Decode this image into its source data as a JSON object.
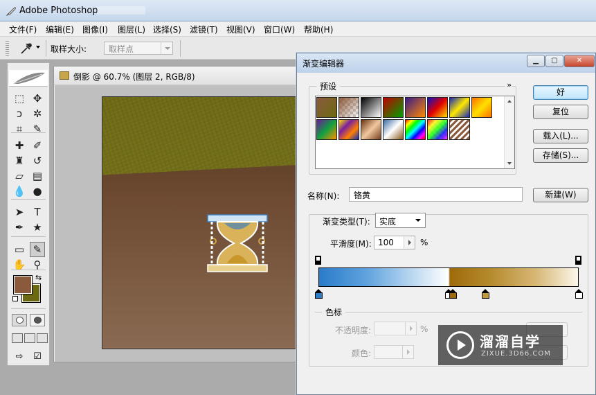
{
  "app": {
    "title": "Adobe Photoshop"
  },
  "menu": [
    {
      "label": "文件(F)"
    },
    {
      "label": "编辑(E)"
    },
    {
      "label": "图像(I)"
    },
    {
      "label": "图层(L)"
    },
    {
      "label": "选择(S)"
    },
    {
      "label": "滤镜(T)"
    },
    {
      "label": "视图(V)"
    },
    {
      "label": "窗口(W)"
    },
    {
      "label": "帮助(H)"
    }
  ],
  "options_bar": {
    "tool_icon": "eyedropper-icon",
    "sample_size_label": "取样大小:",
    "sample_size_value": "取样点"
  },
  "toolbox": {
    "tools": [
      {
        "name": "marquee-icon",
        "glyph": "⬚"
      },
      {
        "name": "move-icon",
        "glyph": "✥"
      },
      {
        "name": "lasso-icon",
        "glyph": "ↄ"
      },
      {
        "name": "magic-wand-icon",
        "glyph": "✲"
      },
      {
        "name": "crop-icon",
        "glyph": "⌗"
      },
      {
        "name": "slice-icon",
        "glyph": "✎"
      },
      {
        "name": "healing-brush-icon",
        "glyph": "✚"
      },
      {
        "name": "brush-icon",
        "glyph": "✐"
      },
      {
        "name": "clone-stamp-icon",
        "glyph": "♜"
      },
      {
        "name": "history-brush-icon",
        "glyph": "↺"
      },
      {
        "name": "eraser-icon",
        "glyph": "▱"
      },
      {
        "name": "gradient-icon",
        "glyph": "▤"
      },
      {
        "name": "blur-icon",
        "glyph": "💧"
      },
      {
        "name": "dodge-icon",
        "glyph": "●"
      },
      {
        "name": "path-selection-icon",
        "glyph": "➤"
      },
      {
        "name": "type-icon",
        "glyph": "T"
      },
      {
        "name": "pen-icon",
        "glyph": "✒"
      },
      {
        "name": "custom-shape-icon",
        "glyph": "★"
      },
      {
        "name": "notes-icon",
        "glyph": "▭"
      },
      {
        "name": "eyedropper-icon",
        "glyph": "✎"
      },
      {
        "name": "hand-icon",
        "glyph": "✋"
      },
      {
        "name": "zoom-icon",
        "glyph": "⚲"
      }
    ],
    "foreground_color": "#8b5a3c",
    "background_color": "#6b6a12"
  },
  "document": {
    "title": "倒影 @ 60.7% (图层 2, RGB/8)"
  },
  "gradient_editor": {
    "title": "渐变编辑器",
    "presets_label": "预设",
    "more_icon": "double-chevron-right-icon",
    "buttons": {
      "ok": "好",
      "reset": "复位",
      "load": "载入(L)...",
      "save": "存储(S)...",
      "new": "新建(W)"
    },
    "presets": [
      {
        "name": "foreground-to-background",
        "css": "linear-gradient(135deg,#8b5a3c,#6b6a12)"
      },
      {
        "name": "foreground-to-transparent",
        "css": "linear-gradient(135deg,#8b5a3c,rgba(139,90,60,0)),repeating-conic-gradient(#ccc 0 25%,#fff 0 50%) 0 0/8px 8px"
      },
      {
        "name": "black-white",
        "css": "linear-gradient(135deg,#000,#fff)"
      },
      {
        "name": "red-green",
        "css": "linear-gradient(135deg,#c00000,#00a000)"
      },
      {
        "name": "violet-orange",
        "css": "linear-gradient(135deg,#3a1a8a,#ff8a00)"
      },
      {
        "name": "blue-red-yellow",
        "css": "linear-gradient(135deg,#1010c0,#e00000,#ffe000)"
      },
      {
        "name": "blue-yellow-blue",
        "css": "linear-gradient(135deg,#1428b8,#ffe800,#1428b8)"
      },
      {
        "name": "orange-yellow-orange",
        "css": "linear-gradient(135deg,#ff7000,#ffe000,#ff7000)"
      },
      {
        "name": "violet-green-orange",
        "css": "linear-gradient(135deg,#6a1a9a,#10a040,#ff9000)"
      },
      {
        "name": "yellow-violet-orange-blue",
        "css": "linear-gradient(135deg,#ffe000,#7a20a0,#ff8000,#1030c0)"
      },
      {
        "name": "copper",
        "css": "linear-gradient(135deg,#6a3210,#f0c8a0,#7a4020)"
      },
      {
        "name": "chrome",
        "css": "linear-gradient(135deg,#3a6aa0,#fff 50%,#8a5a20)"
      },
      {
        "name": "spectrum",
        "css": "linear-gradient(135deg,#ff0000,#ffff00,#00ff00,#00ffff,#0000ff,#ff00ff,#ff0000)"
      },
      {
        "name": "transparent-rainbow",
        "css": "linear-gradient(135deg,rgba(255,0,0,.8),rgba(255,255,0,.8),rgba(0,255,0,.8),rgba(0,0,255,.8),rgba(255,0,255,.8)),repeating-conic-gradient(#ccc 0 25%,#fff 0 50%) 0 0/8px 8px"
      },
      {
        "name": "transparent-stripes",
        "css": "repeating-linear-gradient(135deg,#8b5a3c 0 3px,#fff 3px 6px)"
      }
    ],
    "name_label": "名称(N):",
    "name_value": "铬黄",
    "type_label": "渐变类型(T):",
    "type_value": "实底",
    "smoothness_label": "平滑度(M):",
    "smoothness_value": "100",
    "percent": "%",
    "stops": {
      "label": "色标",
      "opacity_label": "不透明度:",
      "opacity_percent": "%",
      "color_label": "颜色:"
    },
    "color_stops": [
      {
        "position": 0.0,
        "color": "#2a7bc8"
      },
      {
        "position": 0.5,
        "color": "#ffffff"
      },
      {
        "position": 0.516,
        "color": "#9e6a0a"
      },
      {
        "position": 0.64,
        "color": "#c39a3a"
      },
      {
        "position": 1.0,
        "color": "#ffffff"
      }
    ],
    "opacity_stops": [
      {
        "position": 0.0,
        "opacity": 100
      },
      {
        "position": 1.0,
        "opacity": 100
      }
    ]
  },
  "watermark": {
    "title": "溜溜自学",
    "subtitle": "ZIXUE.3D66.COM"
  }
}
